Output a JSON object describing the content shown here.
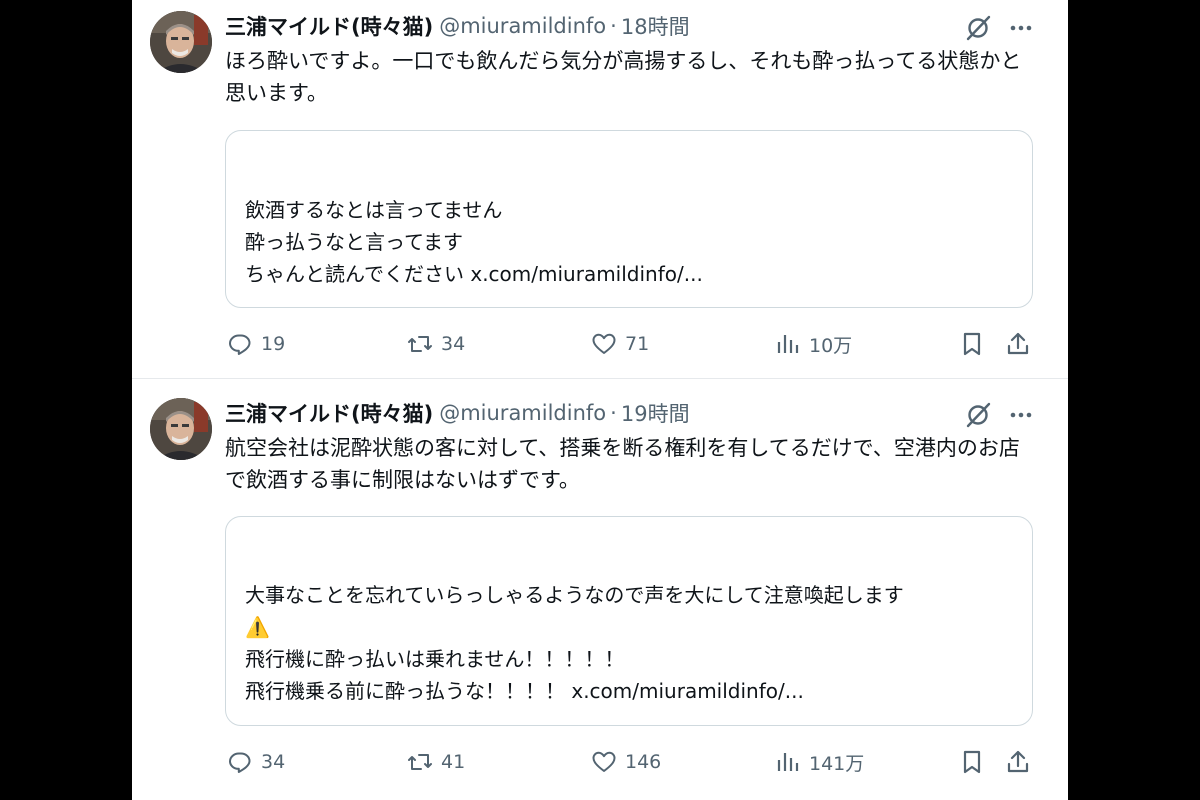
{
  "tweets": [
    {
      "author_name": "三浦マイルド(時々猫)",
      "handle": "@miuramildinfo",
      "separator": "·",
      "time": "18時間",
      "text": "ほろ酔いですよ。一口でも飲んだら気分が高揚するし、それも酔っ払ってる状態かと思います。",
      "quote_lines": [
        "飲酒するなとは言ってません",
        "酔っ払うなと言ってます",
        "ちゃんと読んでください x.com/miuramildinfo/..."
      ],
      "replies": "19",
      "reposts": "34",
      "likes": "71",
      "views": "10万"
    },
    {
      "author_name": "三浦マイルド(時々猫)",
      "handle": "@miuramildinfo",
      "separator": "·",
      "time": "19時間",
      "text": "航空会社は泥酔状態の客に対して、搭乗を断る権利を有してるだけで、空港内のお店で飲酒する事に制限はないはずです。",
      "quote_lines": [
        "大事なことを忘れていらっしゃるようなので声を大にして注意喚起します",
        "⚠️",
        "飛行機に酔っ払いは乗れません！！！！！",
        "飛行機乗る前に酔っ払うな！！！！ x.com/miuramildinfo/..."
      ],
      "replies": "34",
      "reposts": "41",
      "likes": "146",
      "views": "141万"
    }
  ],
  "icons": {
    "reply": "reply-icon",
    "repost": "repost-icon",
    "like": "heart-icon",
    "views": "views-icon",
    "bookmark": "bookmark-icon",
    "share": "share-icon",
    "grok": "grok-icon",
    "more": "more-icon"
  },
  "colors": {
    "text": "#0f1419",
    "secondary": "#536471",
    "border": "#cfd9de",
    "background": "#ffffff",
    "letterbox": "#000000",
    "warning": "#f5b800"
  }
}
